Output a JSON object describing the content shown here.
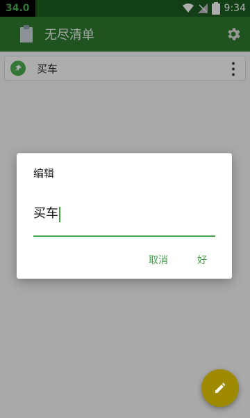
{
  "status_bar": {
    "indicator": "34.0",
    "battery": "8",
    "time": "9:34"
  },
  "app": {
    "title": "无尽清单",
    "icons": {
      "app": "clipboard-icon",
      "settings": "gear-icon"
    }
  },
  "list": {
    "items": [
      {
        "label": "买车",
        "pinned": true,
        "pin_icon": "pin-icon",
        "menu_icon": "more-vert-icon"
      }
    ]
  },
  "dialog": {
    "title": "编辑",
    "input_value": "买车",
    "cancel_label": "取消",
    "ok_label": "好"
  },
  "fab": {
    "icon": "edit-icon"
  },
  "colors": {
    "primary": "#2e7d32",
    "primary_dark": "#1b5e20",
    "accent": "#43a047",
    "fab": "#9e8a00"
  }
}
